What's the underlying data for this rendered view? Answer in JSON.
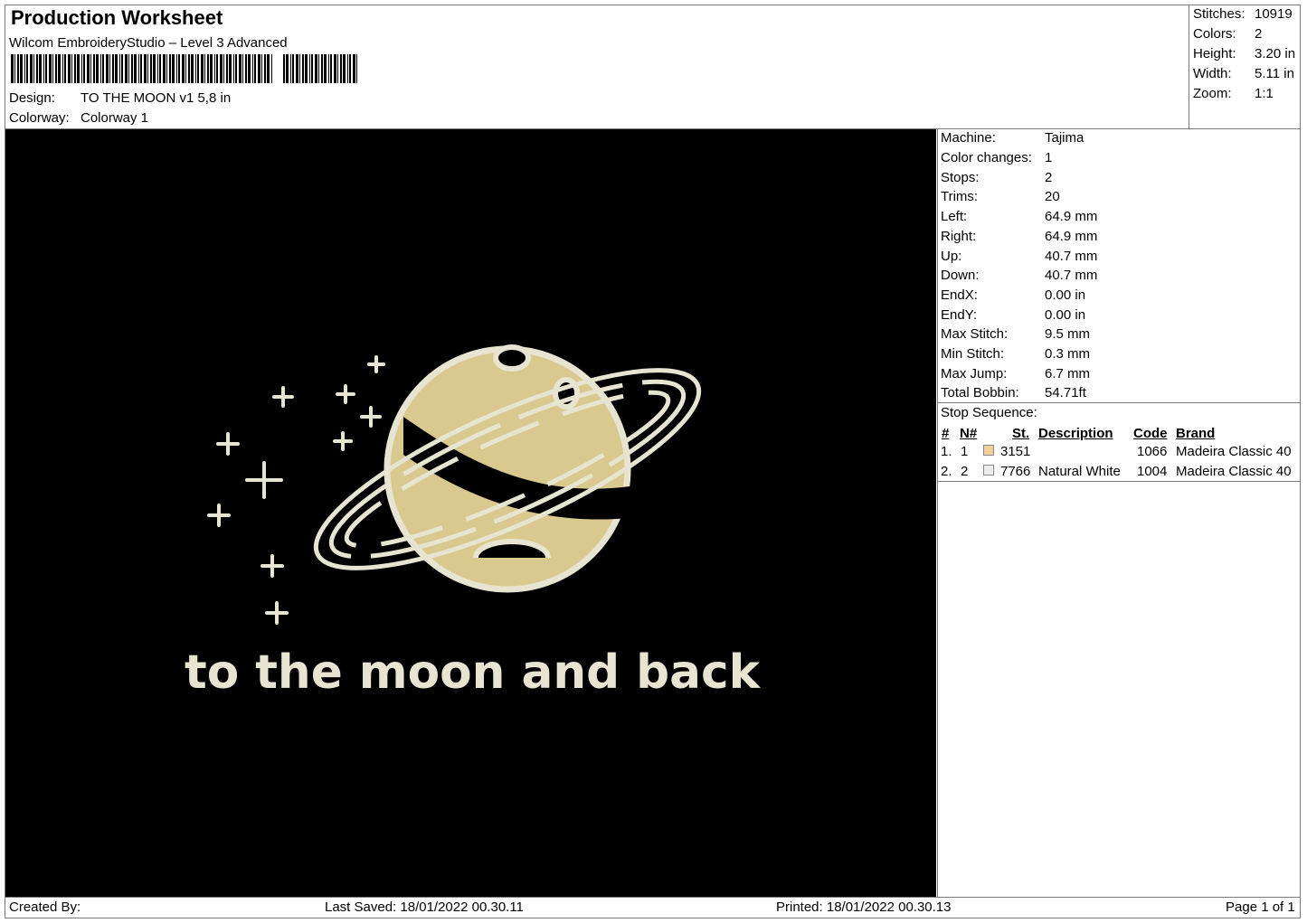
{
  "header": {
    "title": "Production Worksheet",
    "software": "Wilcom EmbroideryStudio – Level 3 Advanced",
    "design_label": "Design:",
    "design_value": "TO THE MOON v1 5,8 in",
    "colorway_label": "Colorway:",
    "colorway_value": "Colorway 1"
  },
  "summary": [
    {
      "label": "Stitches:",
      "value": "10919"
    },
    {
      "label": "Colors:",
      "value": "2"
    },
    {
      "label": "Height:",
      "value": "3.20 in"
    },
    {
      "label": "Width:",
      "value": "5.11 in"
    },
    {
      "label": "Zoom:",
      "value": "1:1"
    }
  ],
  "machine_info": [
    {
      "label": "Machine:",
      "value": "Tajima"
    },
    {
      "label": "Color changes:",
      "value": "1"
    },
    {
      "label": "Stops:",
      "value": "2"
    },
    {
      "label": "Trims:",
      "value": "20"
    },
    {
      "label": "Left:",
      "value": "64.9 mm"
    },
    {
      "label": "Right:",
      "value": "64.9 mm"
    },
    {
      "label": "Up:",
      "value": "40.7 mm"
    },
    {
      "label": "Down:",
      "value": "40.7 mm"
    },
    {
      "label": "EndX:",
      "value": "0.00 in"
    },
    {
      "label": "EndY:",
      "value": "0.00 in"
    },
    {
      "label": "Max Stitch:",
      "value": "9.5 mm"
    },
    {
      "label": "Min Stitch:",
      "value": "0.3 mm"
    },
    {
      "label": "Max Jump:",
      "value": "6.7 mm"
    },
    {
      "label": "Total Bobbin:",
      "value": "54.71ft"
    }
  ],
  "stop_sequence": {
    "title": "Stop Sequence:",
    "columns": [
      "#",
      "N#",
      "St.",
      "Description",
      "Code",
      "Brand"
    ],
    "rows": [
      {
        "idx": "1.",
        "n": "1",
        "swatch": "#f3cf9b",
        "st": "3151",
        "description": "",
        "code": "1066",
        "brand": "Madeira Classic 40"
      },
      {
        "idx": "2.",
        "n": "2",
        "swatch": "#ececec",
        "st": "7766",
        "description": "Natural White",
        "code": "1004",
        "brand": "Madeira Classic 40"
      }
    ]
  },
  "design_preview": {
    "text": "to the moon and back",
    "background": "#000000",
    "thread_white": "#e8e4d2",
    "thread_gold": "#d9c98f"
  },
  "footer": {
    "created_by": "Created By:",
    "last_saved": "Last Saved: 18/01/2022 00.30.11",
    "printed": "Printed: 18/01/2022 00.30.13",
    "page": "Page 1 of 1"
  }
}
